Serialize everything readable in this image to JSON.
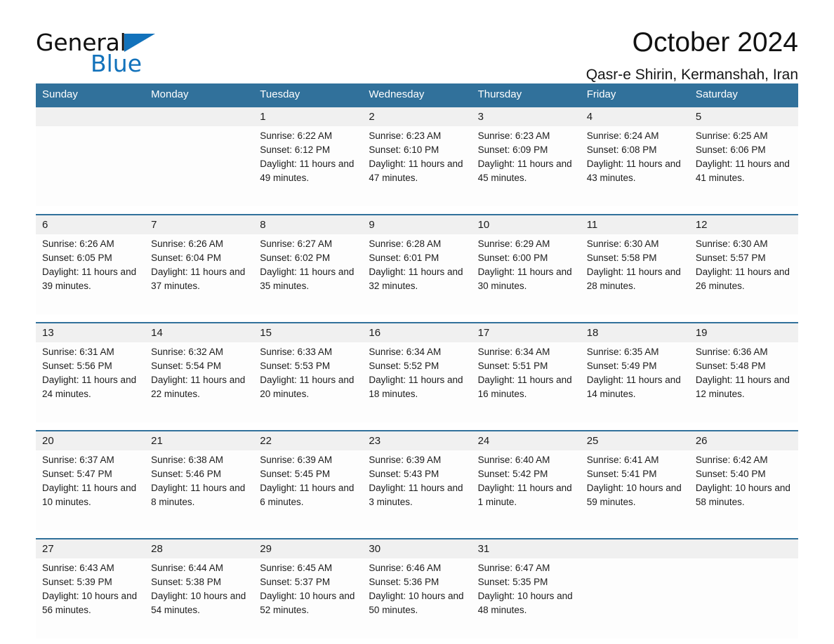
{
  "brand": {
    "word1": "General",
    "word2": "Blue",
    "triangle_color": "#1272bb",
    "word1_color": "#101010",
    "word2_color": "#1272bb"
  },
  "header": {
    "title": "October 2024",
    "location": "Qasr-e Shirin, Kermanshah, Iran"
  },
  "colors": {
    "header_bar": "#31719b",
    "daynum_band": "#f0f0f0",
    "cell_bg": "#fdfdfd",
    "text": "#1c1c1c"
  },
  "weekdays": [
    "Sunday",
    "Monday",
    "Tuesday",
    "Wednesday",
    "Thursday",
    "Friday",
    "Saturday"
  ],
  "weeks": [
    [
      {
        "day": "",
        "sunrise": "",
        "sunset": "",
        "daylight": ""
      },
      {
        "day": "",
        "sunrise": "",
        "sunset": "",
        "daylight": ""
      },
      {
        "day": "1",
        "sunrise": "Sunrise: 6:22 AM",
        "sunset": "Sunset: 6:12 PM",
        "daylight": "Daylight: 11 hours and 49 minutes."
      },
      {
        "day": "2",
        "sunrise": "Sunrise: 6:23 AM",
        "sunset": "Sunset: 6:10 PM",
        "daylight": "Daylight: 11 hours and 47 minutes."
      },
      {
        "day": "3",
        "sunrise": "Sunrise: 6:23 AM",
        "sunset": "Sunset: 6:09 PM",
        "daylight": "Daylight: 11 hours and 45 minutes."
      },
      {
        "day": "4",
        "sunrise": "Sunrise: 6:24 AM",
        "sunset": "Sunset: 6:08 PM",
        "daylight": "Daylight: 11 hours and 43 minutes."
      },
      {
        "day": "5",
        "sunrise": "Sunrise: 6:25 AM",
        "sunset": "Sunset: 6:06 PM",
        "daylight": "Daylight: 11 hours and 41 minutes."
      }
    ],
    [
      {
        "day": "6",
        "sunrise": "Sunrise: 6:26 AM",
        "sunset": "Sunset: 6:05 PM",
        "daylight": "Daylight: 11 hours and 39 minutes."
      },
      {
        "day": "7",
        "sunrise": "Sunrise: 6:26 AM",
        "sunset": "Sunset: 6:04 PM",
        "daylight": "Daylight: 11 hours and 37 minutes."
      },
      {
        "day": "8",
        "sunrise": "Sunrise: 6:27 AM",
        "sunset": "Sunset: 6:02 PM",
        "daylight": "Daylight: 11 hours and 35 minutes."
      },
      {
        "day": "9",
        "sunrise": "Sunrise: 6:28 AM",
        "sunset": "Sunset: 6:01 PM",
        "daylight": "Daylight: 11 hours and 32 minutes."
      },
      {
        "day": "10",
        "sunrise": "Sunrise: 6:29 AM",
        "sunset": "Sunset: 6:00 PM",
        "daylight": "Daylight: 11 hours and 30 minutes."
      },
      {
        "day": "11",
        "sunrise": "Sunrise: 6:30 AM",
        "sunset": "Sunset: 5:58 PM",
        "daylight": "Daylight: 11 hours and 28 minutes."
      },
      {
        "day": "12",
        "sunrise": "Sunrise: 6:30 AM",
        "sunset": "Sunset: 5:57 PM",
        "daylight": "Daylight: 11 hours and 26 minutes."
      }
    ],
    [
      {
        "day": "13",
        "sunrise": "Sunrise: 6:31 AM",
        "sunset": "Sunset: 5:56 PM",
        "daylight": "Daylight: 11 hours and 24 minutes."
      },
      {
        "day": "14",
        "sunrise": "Sunrise: 6:32 AM",
        "sunset": "Sunset: 5:54 PM",
        "daylight": "Daylight: 11 hours and 22 minutes."
      },
      {
        "day": "15",
        "sunrise": "Sunrise: 6:33 AM",
        "sunset": "Sunset: 5:53 PM",
        "daylight": "Daylight: 11 hours and 20 minutes."
      },
      {
        "day": "16",
        "sunrise": "Sunrise: 6:34 AM",
        "sunset": "Sunset: 5:52 PM",
        "daylight": "Daylight: 11 hours and 18 minutes."
      },
      {
        "day": "17",
        "sunrise": "Sunrise: 6:34 AM",
        "sunset": "Sunset: 5:51 PM",
        "daylight": "Daylight: 11 hours and 16 minutes."
      },
      {
        "day": "18",
        "sunrise": "Sunrise: 6:35 AM",
        "sunset": "Sunset: 5:49 PM",
        "daylight": "Daylight: 11 hours and 14 minutes."
      },
      {
        "day": "19",
        "sunrise": "Sunrise: 6:36 AM",
        "sunset": "Sunset: 5:48 PM",
        "daylight": "Daylight: 11 hours and 12 minutes."
      }
    ],
    [
      {
        "day": "20",
        "sunrise": "Sunrise: 6:37 AM",
        "sunset": "Sunset: 5:47 PM",
        "daylight": "Daylight: 11 hours and 10 minutes."
      },
      {
        "day": "21",
        "sunrise": "Sunrise: 6:38 AM",
        "sunset": "Sunset: 5:46 PM",
        "daylight": "Daylight: 11 hours and 8 minutes."
      },
      {
        "day": "22",
        "sunrise": "Sunrise: 6:39 AM",
        "sunset": "Sunset: 5:45 PM",
        "daylight": "Daylight: 11 hours and 6 minutes."
      },
      {
        "day": "23",
        "sunrise": "Sunrise: 6:39 AM",
        "sunset": "Sunset: 5:43 PM",
        "daylight": "Daylight: 11 hours and 3 minutes."
      },
      {
        "day": "24",
        "sunrise": "Sunrise: 6:40 AM",
        "sunset": "Sunset: 5:42 PM",
        "daylight": "Daylight: 11 hours and 1 minute."
      },
      {
        "day": "25",
        "sunrise": "Sunrise: 6:41 AM",
        "sunset": "Sunset: 5:41 PM",
        "daylight": "Daylight: 10 hours and 59 minutes."
      },
      {
        "day": "26",
        "sunrise": "Sunrise: 6:42 AM",
        "sunset": "Sunset: 5:40 PM",
        "daylight": "Daylight: 10 hours and 58 minutes."
      }
    ],
    [
      {
        "day": "27",
        "sunrise": "Sunrise: 6:43 AM",
        "sunset": "Sunset: 5:39 PM",
        "daylight": "Daylight: 10 hours and 56 minutes."
      },
      {
        "day": "28",
        "sunrise": "Sunrise: 6:44 AM",
        "sunset": "Sunset: 5:38 PM",
        "daylight": "Daylight: 10 hours and 54 minutes."
      },
      {
        "day": "29",
        "sunrise": "Sunrise: 6:45 AM",
        "sunset": "Sunset: 5:37 PM",
        "daylight": "Daylight: 10 hours and 52 minutes."
      },
      {
        "day": "30",
        "sunrise": "Sunrise: 6:46 AM",
        "sunset": "Sunset: 5:36 PM",
        "daylight": "Daylight: 10 hours and 50 minutes."
      },
      {
        "day": "31",
        "sunrise": "Sunrise: 6:47 AM",
        "sunset": "Sunset: 5:35 PM",
        "daylight": "Daylight: 10 hours and 48 minutes."
      },
      {
        "day": "",
        "sunrise": "",
        "sunset": "",
        "daylight": ""
      },
      {
        "day": "",
        "sunrise": "",
        "sunset": "",
        "daylight": ""
      }
    ]
  ]
}
